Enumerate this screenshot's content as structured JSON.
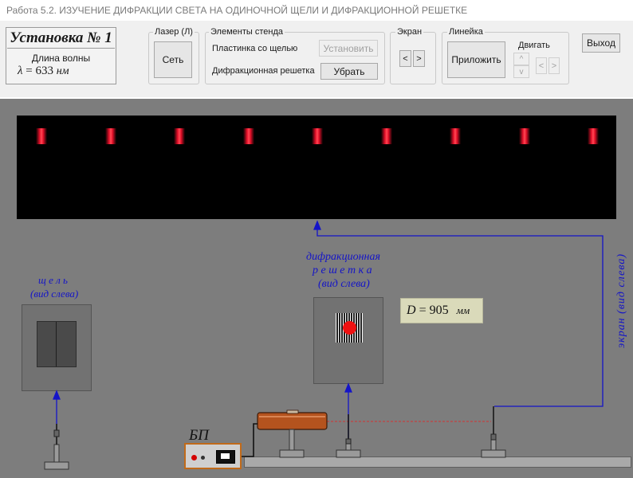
{
  "window": {
    "title": "Работа 5.2. ИЗУЧЕНИЕ ДИФРАКЦИИ СВЕТА НА ОДИНОЧНОЙ ЩЕЛИ И ДИФРАКЦИОННОЙ РЕШЕТКЕ"
  },
  "setup": {
    "title": "Установка № 1",
    "wavelength_label": "Длина волны",
    "lambda_symbol": "λ",
    "lambda_eq": "= 633",
    "lambda_unit": "нм"
  },
  "laser": {
    "group_label": "Лазер (Л)",
    "button": "Сеть"
  },
  "elements": {
    "group_label": "Элементы стенда",
    "slit_plate_label": "Пластинка со щелью",
    "slit_plate_button": "Установить",
    "grating_label": "Дифракционная решетка",
    "grating_button": "Убрать"
  },
  "screen": {
    "group_label": "Экран",
    "left_arrow": "<",
    "right_arrow": ">"
  },
  "ruler": {
    "group_label": "Линейка",
    "apply_button": "Приложить",
    "move_label": "Двигать",
    "up": "^",
    "down": "v",
    "left": "<",
    "right": ">"
  },
  "exit_button": "Выход",
  "stage": {
    "slit_caption": [
      "щ е л ь",
      "(вид слева)"
    ],
    "grating_caption": [
      "дифракционная",
      "р е ш е т к а",
      "(вид слева)"
    ],
    "screen_caption": "экран (вид слева)",
    "distance_symbol": "D",
    "distance_eq": "=  905",
    "distance_unit": "мм",
    "psu_label": "БП"
  },
  "diffraction_pattern": {
    "fringe_color": "#e8102a",
    "fringes": [
      1,
      2,
      3,
      4,
      5,
      6,
      7,
      8,
      9
    ]
  },
  "colors": {
    "stage_bg": "#7d7d7d",
    "screen_bg": "#000000",
    "caption_blue": "#1414c8",
    "laser_tube": "#b4531e",
    "beam": "#d43232"
  }
}
